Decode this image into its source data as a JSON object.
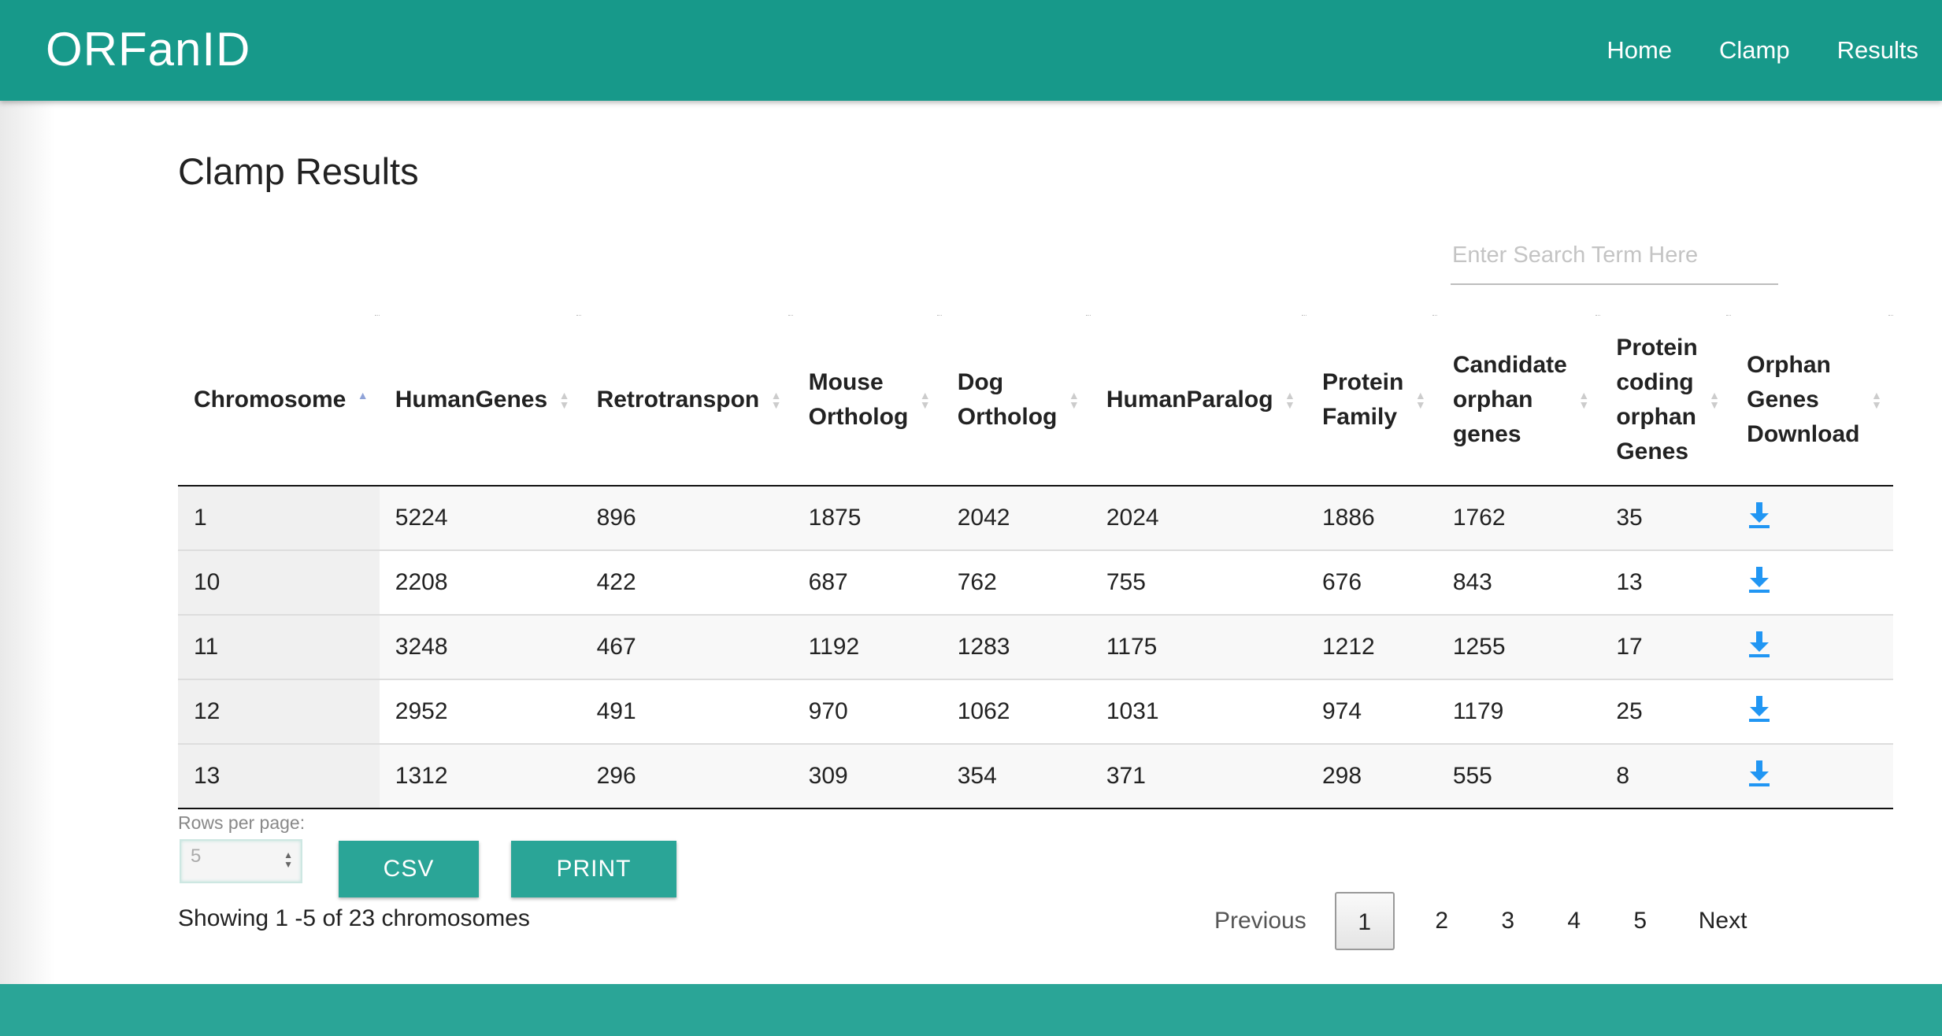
{
  "navbar": {
    "brand": "ORFanID",
    "links": [
      "Home",
      "Clamp",
      "Results"
    ]
  },
  "page": {
    "title": "Clamp Results",
    "search_placeholder": "Enter Search Term Here"
  },
  "table": {
    "columns": [
      "Chromosome",
      "HumanGenes",
      "Retrotranspon",
      "Mouse Ortholog",
      "Dog Ortholog",
      "HumanParalog",
      "Protein Family",
      "Candidate orphan genes",
      "Protein coding orphan Genes",
      "Orphan Genes Download"
    ],
    "sorted_column": "Chromosome",
    "sort_direction": "ascending",
    "rows": [
      [
        "1",
        "5224",
        "896",
        "1875",
        "2042",
        "2024",
        "1886",
        "1762",
        "35"
      ],
      [
        "10",
        "2208",
        "422",
        "687",
        "762",
        "755",
        "676",
        "843",
        "13"
      ],
      [
        "11",
        "3248",
        "467",
        "1192",
        "1283",
        "1175",
        "1212",
        "1255",
        "17"
      ],
      [
        "12",
        "2952",
        "491",
        "970",
        "1062",
        "1031",
        "974",
        "1179",
        "25"
      ],
      [
        "13",
        "1312",
        "296",
        "309",
        "354",
        "371",
        "298",
        "555",
        "8"
      ]
    ],
    "download_icon": "download-icon",
    "download_color": "#2196f3"
  },
  "controls": {
    "rows_per_page_label": "Rows per page:",
    "rows_per_page_value": "5",
    "csv_label": "CSV",
    "print_label": "PRINT",
    "showing_text": "Showing 1 -5 of 23 chromosomes"
  },
  "pagination": {
    "previous": "Previous",
    "pages": [
      "1",
      "2",
      "3",
      "4",
      "5"
    ],
    "active_page": "1",
    "next": "Next"
  },
  "colors": {
    "navbar": "#17998a",
    "button": "#2aa597",
    "footer": "#2aa597"
  }
}
